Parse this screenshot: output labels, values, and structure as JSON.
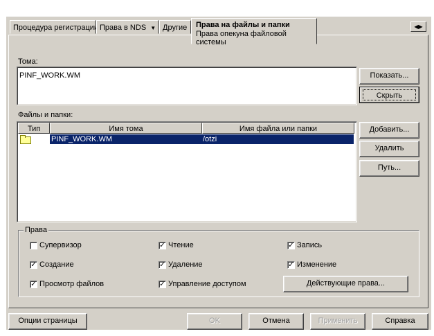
{
  "tabs": [
    {
      "label": "Процедура регистрации"
    },
    {
      "label": "Права в NDS",
      "has_dropdown": true
    },
    {
      "label": "Другие"
    }
  ],
  "active_tab": {
    "title": "Права на файлы и папки",
    "subtitle": "Права опекуна файловой системы"
  },
  "volumes": {
    "label": "Тома:",
    "items": [
      "PINF_WORK.WM"
    ],
    "show_button": "Показать...",
    "hide_button": "Скрыть"
  },
  "files": {
    "label": "Файлы и папки:",
    "columns": [
      "Тип",
      "Имя тома",
      "Имя файла или папки"
    ],
    "rows": [
      {
        "type_icon": "folder-icon",
        "volume": "PINF_WORK.WM",
        "path": "/otzi",
        "selected": true
      }
    ],
    "add_button": "Добавить...",
    "delete_button": "Удалить",
    "path_button": "Путь..."
  },
  "rights": {
    "title": "Права",
    "items": [
      {
        "label": "Супервизор",
        "checked": false
      },
      {
        "label": "Чтение",
        "checked": true
      },
      {
        "label": "Запись",
        "checked": true
      },
      {
        "label": "Создание",
        "checked": true
      },
      {
        "label": "Удаление",
        "checked": true
      },
      {
        "label": "Изменение",
        "checked": true
      },
      {
        "label": "Просмотр файлов",
        "checked": true
      },
      {
        "label": "Управление доступом",
        "checked": true
      }
    ],
    "effective_button": "Действующие права..."
  },
  "bottom": {
    "page_options": "Опции страницы",
    "ok": "OK",
    "cancel": "Отмена",
    "apply": "Применить",
    "help": "Справка"
  },
  "check_glyph": "✓"
}
